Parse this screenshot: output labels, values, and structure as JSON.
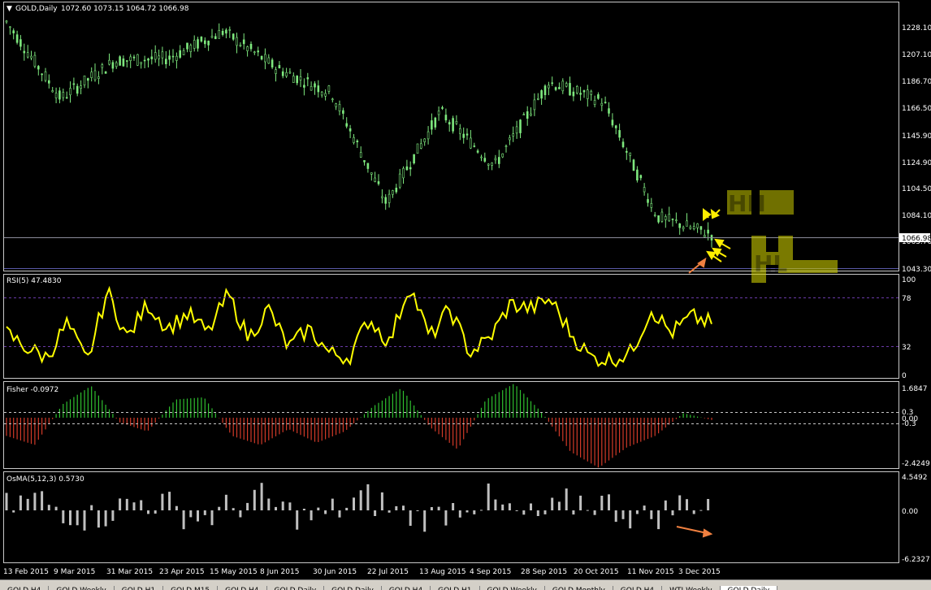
{
  "main_label": "GOLD,Daily",
  "ohlc_text": "1072.60 1073.15 1064.72 1066.98",
  "price_axis": [
    "1228.10",
    "1207.10",
    "1186.70",
    "1166.50",
    "1145.90",
    "1124.90",
    "1104.50",
    "1084.10",
    "1063.70",
    "1043.30"
  ],
  "current_price": "1066.98",
  "rsi_label": "RSI(5) 47.4830",
  "rsi_axis": [
    "100",
    "78",
    "32",
    "0"
  ],
  "fisher_label": "Fisher -0.0972",
  "fisher_axis": [
    "1.6847",
    "0.3",
    "0.00",
    "-0.3",
    "-2.4249"
  ],
  "osma_label": "OsMA(5,12,3) 0.5730",
  "osma_axis": [
    "4.5492",
    "0.00",
    "-6.2327"
  ],
  "date_axis": [
    "13 Feb 2015",
    "9 Mar 2015",
    "31 Mar 2015",
    "23 Apr 2015",
    "15 May 2015",
    "8 Jun 2015",
    "30 Jun 2015",
    "22 Jul 2015",
    "13 Aug 2015",
    "4 Sep 2015",
    "28 Sep 2015",
    "20 Oct 2015",
    "11 Nov 2015",
    "3 Dec 2015"
  ],
  "tabs": [
    "GOLD,H4",
    "GOLD,Weekly",
    "GOLD,H1",
    "GOLD,M15",
    "GOLD,H4",
    "GOLD,Daily",
    "GOLD,Daily",
    "GOLD,H4",
    "GOLD,H1",
    "GOLD,Weekly",
    "GOLD,Monthly",
    "GOLD,H4",
    "WTI,Weekly",
    "GOLD,Daily"
  ],
  "active_tab_index": 13,
  "annotation_text_1": "HH",
  "annotation_text_2": "HL",
  "colors": {
    "candle": "#7ee87e",
    "rsi": "#ffff00",
    "fisher_pos": "#2fbf2f",
    "fisher_neg": "#d23a28",
    "osma": "#c0c0c0",
    "arrow_yellow": "#ffee00",
    "arrow_orange": "#f08040"
  },
  "chart_data": [
    {
      "type": "candlestick",
      "title": "GOLD,Daily",
      "ylim": [
        1040,
        1240
      ],
      "x": [
        "13 Feb 2015",
        "9 Mar 2015",
        "31 Mar 2015",
        "23 Apr 2015",
        "15 May 2015",
        "8 Jun 2015",
        "30 Jun 2015",
        "22 Jul 2015",
        "13 Aug 2015",
        "4 Sep 2015",
        "28 Sep 2015",
        "20 Oct 2015",
        "11 Nov 2015",
        "3 Dec 2015"
      ],
      "close_approx": [
        1225,
        1168,
        1196,
        1198,
        1218,
        1190,
        1172,
        1090,
        1158,
        1118,
        1180,
        1166,
        1080,
        1067
      ],
      "last_bar": {
        "open": 1072.6,
        "high": 1073.15,
        "low": 1064.72,
        "close": 1066.98
      }
    },
    {
      "type": "line",
      "title": "RSI(5)",
      "ylim": [
        0,
        100
      ],
      "levels": [
        78,
        32
      ],
      "last": 47.483
    },
    {
      "type": "bar",
      "title": "Fisher",
      "ylim": [
        -2.4249,
        1.6847
      ],
      "levels": [
        0.3,
        -0.3
      ],
      "last": -0.0972
    },
    {
      "type": "bar",
      "title": "OsMA(5,12,3)",
      "ylim": [
        -6.2327,
        4.5492
      ],
      "last": 0.573
    }
  ]
}
